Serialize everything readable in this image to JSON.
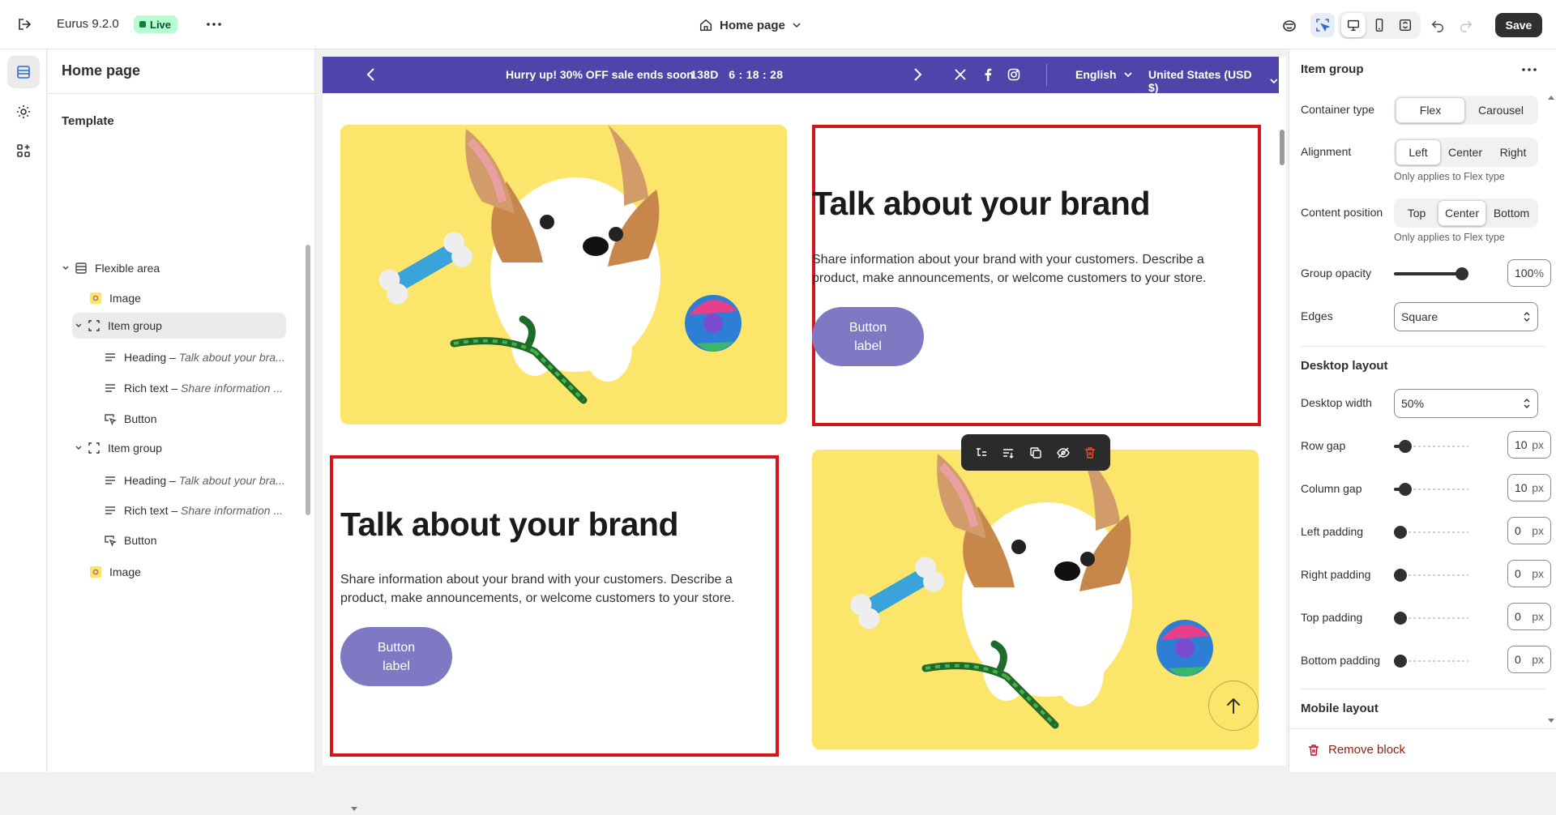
{
  "topbar": {
    "theme_name": "Eurus 9.2.0",
    "status": "Live",
    "page_selector": "Home page",
    "save": "Save"
  },
  "left_panel": {
    "title": "Home page",
    "section": "Template",
    "tree": [
      {
        "label": "Flexible area",
        "detail": ""
      },
      {
        "label": "Image",
        "detail": ""
      },
      {
        "label": "Item group",
        "detail": ""
      },
      {
        "label": "Heading",
        "detail": "Talk about your bra..."
      },
      {
        "label": "Rich text",
        "detail": "Share information ..."
      },
      {
        "label": "Button",
        "detail": ""
      },
      {
        "label": "Item group",
        "detail": ""
      },
      {
        "label": "Heading",
        "detail": "Talk about your bra..."
      },
      {
        "label": "Rich text",
        "detail": "Share information ..."
      },
      {
        "label": "Button",
        "detail": ""
      },
      {
        "label": "Image",
        "detail": ""
      }
    ],
    "separator": "–"
  },
  "preview": {
    "announcement": {
      "text": "Hurry up! 30% OFF sale ends soon",
      "countdown": "138D   6 : 18 : 28",
      "language": "English",
      "currency": "United States (USD $)"
    },
    "blocks": [
      {
        "heading": "Talk about your brand",
        "body": "Share information about your brand with your customers. Describe a product, make announcements, or welcome customers to your store.",
        "button": "Button label"
      },
      {
        "heading": "Talk about your brand",
        "body": "Share information about your brand with your customers. Describe a product, make announcements, or welcome customers to your store.",
        "button": "Button label"
      }
    ]
  },
  "right_panel": {
    "title": "Item group",
    "container_type": {
      "label": "Container type",
      "options": [
        "Flex",
        "Carousel"
      ],
      "selected": "Flex"
    },
    "alignment": {
      "label": "Alignment",
      "options": [
        "Left",
        "Center",
        "Right"
      ],
      "selected": "Left",
      "hint": "Only applies to Flex type"
    },
    "content_position": {
      "label": "Content position",
      "options": [
        "Top",
        "Center",
        "Bottom"
      ],
      "selected": "Center",
      "hint": "Only applies to Flex type"
    },
    "group_opacity": {
      "label": "Group opacity",
      "value": "100",
      "unit": "%",
      "fraction": 1.0
    },
    "edges": {
      "label": "Edges",
      "value": "Square"
    },
    "desktop_layout": {
      "title": "Desktop layout",
      "width_label": "Desktop width",
      "width_value": "50%",
      "sliders": [
        {
          "label": "Row gap",
          "value": "10",
          "unit": "px",
          "fraction": 0.08
        },
        {
          "label": "Column gap",
          "value": "10",
          "unit": "px",
          "fraction": 0.08
        },
        {
          "label": "Left padding",
          "value": "0",
          "unit": "px",
          "fraction": 0
        },
        {
          "label": "Right padding",
          "value": "0",
          "unit": "px",
          "fraction": 0
        },
        {
          "label": "Top padding",
          "value": "0",
          "unit": "px",
          "fraction": 0
        },
        {
          "label": "Bottom padding",
          "value": "0",
          "unit": "px",
          "fraction": 0
        }
      ]
    },
    "mobile_layout": "Mobile layout",
    "remove": "Remove block"
  },
  "colors": {
    "announcement_bg": "#4e44a9",
    "selection_outline": "#d7141a",
    "button_pill": "#7f79c4",
    "live_badge": "#b4fed2",
    "image_bg": "#fce56b"
  }
}
